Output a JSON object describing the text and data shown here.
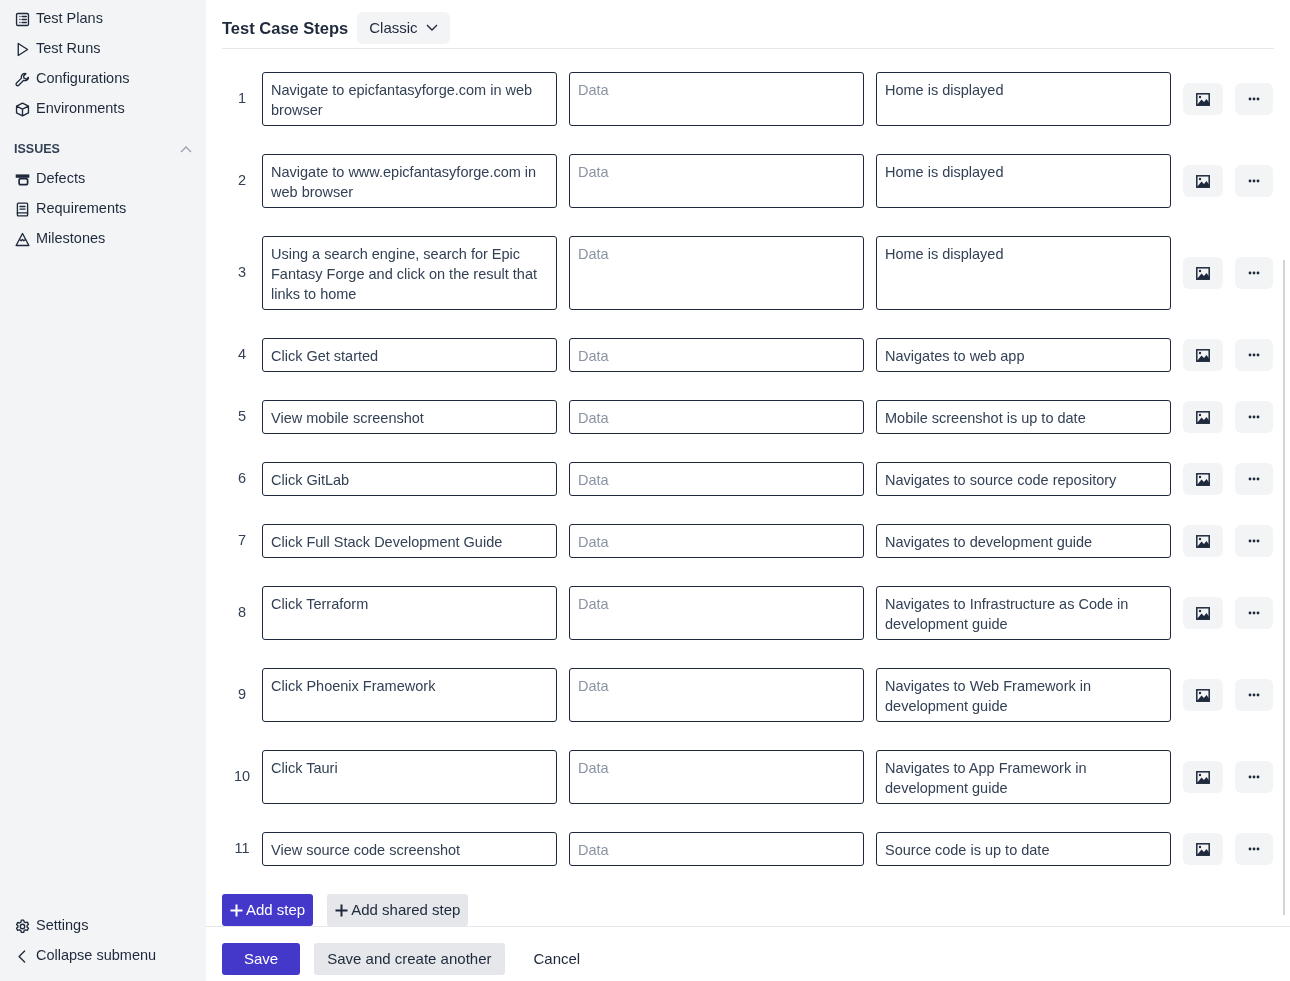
{
  "sidebar": {
    "top_items": [
      {
        "label": "Test Plans"
      },
      {
        "label": "Test Runs"
      },
      {
        "label": "Configurations"
      },
      {
        "label": "Environments"
      }
    ],
    "issues_section": {
      "title": "ISSUES",
      "expanded": true,
      "items": [
        {
          "label": "Defects"
        },
        {
          "label": "Requirements"
        },
        {
          "label": "Milestones"
        }
      ]
    },
    "bottom_items": [
      {
        "label": "Settings"
      },
      {
        "label": "Collapse submenu"
      }
    ]
  },
  "steps_header": {
    "title": "Test Case Steps",
    "view_select": "Classic"
  },
  "steps": [
    {
      "number": "1",
      "action": "Navigate to epicfantasyforge.com in web browser",
      "data_placeholder": "Data",
      "expected": "Home is displayed"
    },
    {
      "number": "2",
      "action": "Navigate to www.epicfantasyforge.com in web browser",
      "data_placeholder": "Data",
      "expected": "Home is displayed"
    },
    {
      "number": "3",
      "action": "Using a search engine, search for Epic Fantasy Forge and click on the result that links to home",
      "data_placeholder": "Data",
      "expected": "Home is displayed"
    },
    {
      "number": "4",
      "action": "Click Get started",
      "data_placeholder": "Data",
      "expected": "Navigates to web app"
    },
    {
      "number": "5",
      "action": "View mobile screenshot",
      "data_placeholder": "Data",
      "expected": "Mobile screenshot is up to date"
    },
    {
      "number": "6",
      "action": "Click GitLab",
      "data_placeholder": "Data",
      "expected": "Navigates to source code repository"
    },
    {
      "number": "7",
      "action": "Click Full Stack Development Guide",
      "data_placeholder": "Data",
      "expected": "Navigates to development guide"
    },
    {
      "number": "8",
      "action": "Click Terraform",
      "data_placeholder": "Data",
      "expected": "Navigates to Infrastructure as Code in development guide"
    },
    {
      "number": "9",
      "action": "Click Phoenix Framework",
      "data_placeholder": "Data",
      "expected": "Navigates to Web Framework in development guide"
    },
    {
      "number": "10",
      "action": "Click Tauri",
      "data_placeholder": "Data",
      "expected": "Navigates to App Framework in development guide"
    },
    {
      "number": "11",
      "action": "View source code screenshot",
      "data_placeholder": "Data",
      "expected": "Source code is up to date"
    }
  ],
  "add_buttons": [
    {
      "label": "Add step",
      "kind": "primary"
    },
    {
      "label": "Add shared step",
      "kind": "secondary"
    }
  ],
  "footer_buttons": [
    {
      "label": "Save",
      "kind": "primary"
    },
    {
      "label": "Save and create another",
      "kind": "secondary"
    },
    {
      "label": "Cancel",
      "kind": "link"
    }
  ]
}
